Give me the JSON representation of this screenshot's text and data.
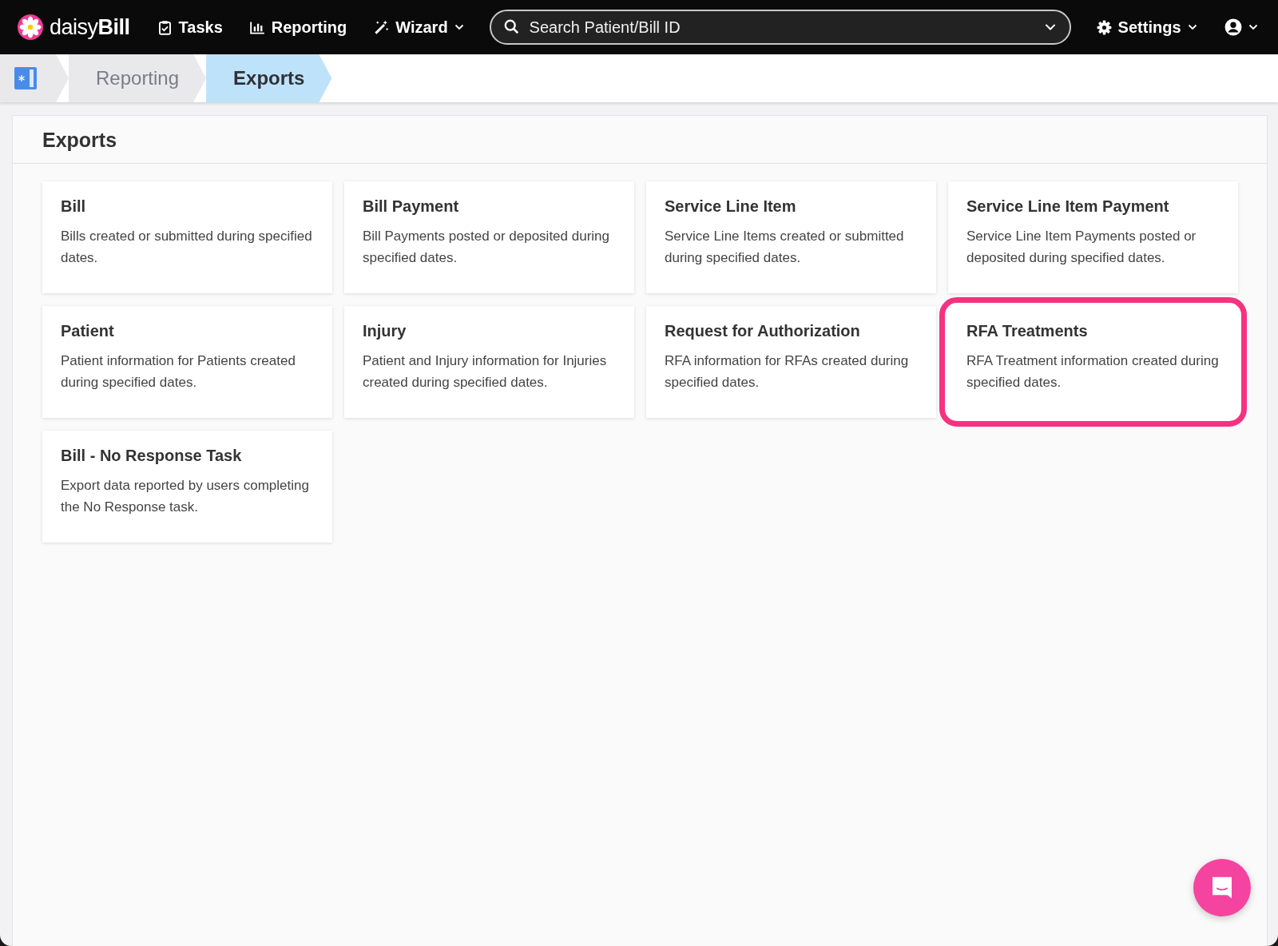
{
  "topbar": {
    "logo_text": "daisy",
    "logo_bold": "Bill",
    "nav": [
      {
        "label": "Tasks",
        "kind": "tasks",
        "dropdown": false
      },
      {
        "label": "Reporting",
        "kind": "reporting",
        "dropdown": false
      },
      {
        "label": "Wizard",
        "kind": "wizard",
        "dropdown": true
      }
    ],
    "search": {
      "placeholder": "Search Patient/Bill ID"
    },
    "settings": {
      "label": "Settings"
    }
  },
  "breadcrumb": [
    {
      "label": "Reporting",
      "selected": false
    },
    {
      "label": "Exports",
      "selected": true
    }
  ],
  "panel": {
    "title": "Exports"
  },
  "cards": [
    {
      "title": "Bill",
      "description": "Bills created or submitted during specified dates.",
      "highlighted": false
    },
    {
      "title": "Bill Payment",
      "description": "Bill Payments posted or deposited during specified dates.",
      "highlighted": false
    },
    {
      "title": "Service Line Item",
      "description": "Service Line Items created or submitted during specified dates.",
      "highlighted": false
    },
    {
      "title": "Service Line Item Payment",
      "description": "Service Line Item Payments posted or deposited during specified dates.",
      "highlighted": false
    },
    {
      "title": "Patient",
      "description": "Patient information for Patients created during specified dates.",
      "highlighted": false
    },
    {
      "title": "Injury",
      "description": "Patient and Injury information for Injuries created during specified dates.",
      "highlighted": false
    },
    {
      "title": "Request for Authorization",
      "description": "RFA information for RFAs created during specified dates.",
      "highlighted": false
    },
    {
      "title": "RFA Treatments",
      "description": "RFA Treatment information created during specified dates.",
      "highlighted": true
    },
    {
      "title": "Bill - No Response Task",
      "description": "Export data reported by users completing the No Response task.",
      "highlighted": false
    }
  ]
}
